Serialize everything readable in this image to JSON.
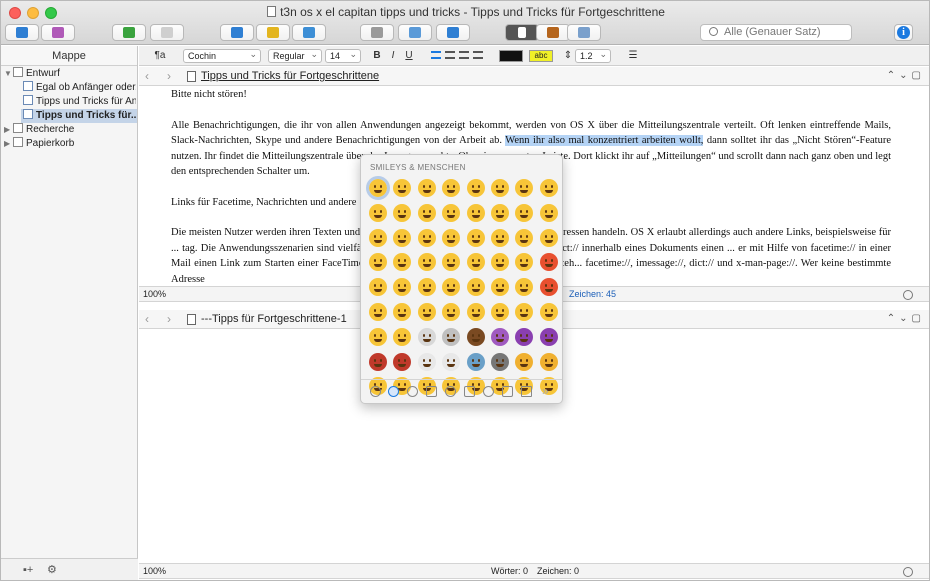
{
  "window": {
    "title": "t3n os x el capitan tipps und tricks - Tipps und Tricks für Fortgeschrittene"
  },
  "toolbar": {
    "search_placeholder": "Alle (Genauer Satz)",
    "info_label": "i"
  },
  "sidebar": {
    "header": "Mappe",
    "items": [
      {
        "label": "Entwurf"
      },
      {
        "label": "Egal ob Anfänger oder..."
      },
      {
        "label": "Tipps und Tricks für An..."
      },
      {
        "label": "Tipps und Tricks für..."
      },
      {
        "label": "Recherche"
      },
      {
        "label": "Papierkorb"
      }
    ]
  },
  "format_bar": {
    "paragraph_style": "¶a",
    "font": "Cochin",
    "weight": "Regular",
    "size": "14",
    "bold": "B",
    "italic": "I",
    "underline": "U",
    "highlight_label": "abc",
    "line_spacing": "1.2"
  },
  "editor_top": {
    "doc_title": "Tipps und Tricks für Fortgeschrittene",
    "paragraphs": [
      "Bitte nicht stören!",
      "Alle Benachrichtigungen, die ihr von allen Anwendungen angezeigt bekommt, werden von OS X über die Mitteilungszentrale verteilt. Oft lenken eintreffende Mails, Slack-Nachrichten, Skype und andere Benachrichtigungen von der Arbeit ab.",
      "Wenn ihr also mal konzentriert arbeiten wollt,",
      "dann solltet ihr das „Nicht Stören“-Feature nutzen. Ihr findet die Mitteilungszentrale über das Icon ganz rechts. Oben in eurer ...tus-Leiste. Dort klickt ihr auf „Mitteilungen“ und scrollt dann nach ganz oben und legt den entsprechenden Schalter um.",
      "Links für Facetime, Nachrichten und andere",
      "Die meisten Nutzer werden ihren Texten und ... in der Regel dürfte es sich dabei um Web-Adressen handeln. OS X erlaubt allerdings auch andere Links, beispielsweise für ... tag. Die Anwendungsszenarien sind vielfältig. So ist es beispielsweise möglich mittels dict:// innerhalb eines Dokuments einen ... er mit Hilfe von facetime:// in einer Mail einen Link zum Starten einer FaceTime-Konversation zu integrieren. Zur Verfügung steh... facetime://, imessage://, dict:// und x-man-page://. Wer keine bestimmte Adresse"
    ],
    "zoom": "100%",
    "char_count": "Zeichen: 45"
  },
  "editor_bottom": {
    "doc_title": "---Tipps für Fortgeschrittene-1",
    "zoom": "100%",
    "words": "Wörter: 0",
    "chars": "Zeichen: 0"
  },
  "emoji_picker": {
    "section_title": "SMILEYS & MENSCHEN",
    "more_label": "»"
  },
  "colors": {
    "accent": "#1c7ae0",
    "selection": "#b4d3f5",
    "emoji_yellow": "#f7c538"
  }
}
